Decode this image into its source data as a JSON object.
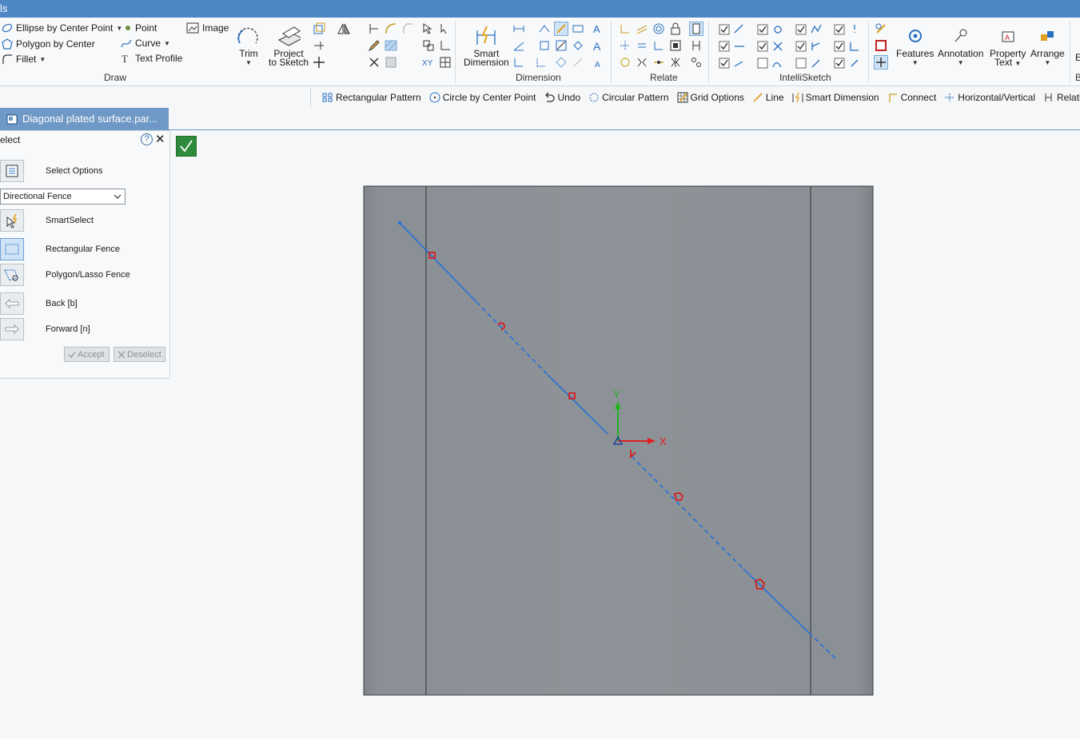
{
  "titlebar": {
    "text": "ls"
  },
  "ribbon": {
    "draw": {
      "label": "Draw",
      "ellipse": "Ellipse by Center Point",
      "polygon": "Polygon by Center",
      "fillet": "Fillet",
      "point": "Point",
      "curve": "Curve",
      "text_profile": "Text Profile",
      "image": "Image",
      "trim": "Trim",
      "project_line1": "Project",
      "project_line2": "to Sketch"
    },
    "dimension": {
      "label": "Dimension",
      "smart_line1": "Smart",
      "smart_line2": "Dimension"
    },
    "relate": {
      "label": "Relate"
    },
    "intellisketch": {
      "label": "IntelliSketch"
    },
    "right": {
      "features": "Features",
      "annotation": "Annotation",
      "property_line1": "Property",
      "property_line2": "Text",
      "arrange": "Arrange",
      "cut1": "E",
      "cut2": "B"
    }
  },
  "cmdbar": {
    "items": [
      "Rectangular Pattern",
      "Circle by Center Point",
      "Undo",
      "Circular Pattern",
      "Grid Options",
      "Line",
      "Smart Dimension",
      "Connect",
      "Horizontal/Vertical",
      "Relationship H"
    ]
  },
  "doctab": {
    "title": "Diagonal plated surface.par..."
  },
  "panel": {
    "title": "elect",
    "help": "?",
    "select_options": "Select Options",
    "fence_mode": "Directional Fence",
    "smartselect": "SmartSelect",
    "rect_fence": "Rectangular Fence",
    "poly_fence": "Polygon/Lasso Fence",
    "back": "Back [b]",
    "forward": "Forward [n]",
    "accept": "Accept",
    "deselect": "Deselect"
  },
  "canvas": {
    "axis_x": "X",
    "axis_y": "Y",
    "colors": {
      "plate": "#8c9297",
      "line": "#1f6fe0",
      "relation": "#e01010",
      "axis_x": "#e02020",
      "axis_y": "#22b422",
      "accept": "#2e8b3d"
    }
  }
}
